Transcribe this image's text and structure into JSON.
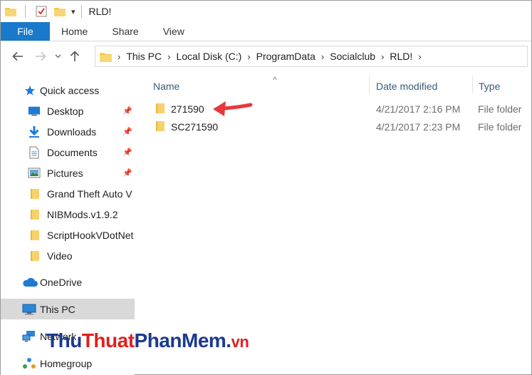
{
  "window": {
    "title": "RLD!"
  },
  "ribbon": {
    "tabs": [
      {
        "label": "File",
        "active": true
      },
      {
        "label": "Home"
      },
      {
        "label": "Share"
      },
      {
        "label": "View"
      }
    ]
  },
  "address": {
    "crumbs": [
      "This PC",
      "Local Disk (C:)",
      "ProgramData",
      "Socialclub",
      "RLD!"
    ],
    "separator": "›"
  },
  "sidebar": {
    "items": [
      {
        "label": "Quick access",
        "icon": "star-icon"
      },
      {
        "label": "Desktop",
        "icon": "desktop-icon",
        "pinned": true
      },
      {
        "label": "Downloads",
        "icon": "download-icon",
        "pinned": true
      },
      {
        "label": "Documents",
        "icon": "documents-icon",
        "pinned": true
      },
      {
        "label": "Pictures",
        "icon": "pictures-icon",
        "pinned": true
      },
      {
        "label": "Grand Theft Auto V",
        "icon": "folder-icon"
      },
      {
        "label": "NIBMods.v1.9.2",
        "icon": "folder-icon"
      },
      {
        "label": "ScriptHookVDotNet",
        "icon": "folder-icon"
      },
      {
        "label": "Video",
        "icon": "folder-icon"
      },
      {
        "label": "OneDrive",
        "icon": "cloud-icon"
      },
      {
        "label": "This PC",
        "icon": "computer-icon",
        "selected": true
      },
      {
        "label": "Network",
        "icon": "network-icon"
      },
      {
        "label": "Homegroup",
        "icon": "homegroup-icon"
      }
    ]
  },
  "columns": {
    "name": "Name",
    "date": "Date modified",
    "type": "Type"
  },
  "files": [
    {
      "name": "271590",
      "date": "4/21/2017 2:16 PM",
      "type": "File folder"
    },
    {
      "name": "SC271590",
      "date": "4/21/2017 2:23 PM",
      "type": "File folder"
    }
  ],
  "watermark": {
    "part1": "Thu",
    "part2": "Thuat",
    "part3": "Phan",
    "part4": "Mem",
    "dot": ".",
    "tld": "vn"
  },
  "colors": {
    "file_tab": "#1979ca",
    "annotation_arrow": "#e8383d",
    "folder_yellow": "#f7d26b"
  }
}
